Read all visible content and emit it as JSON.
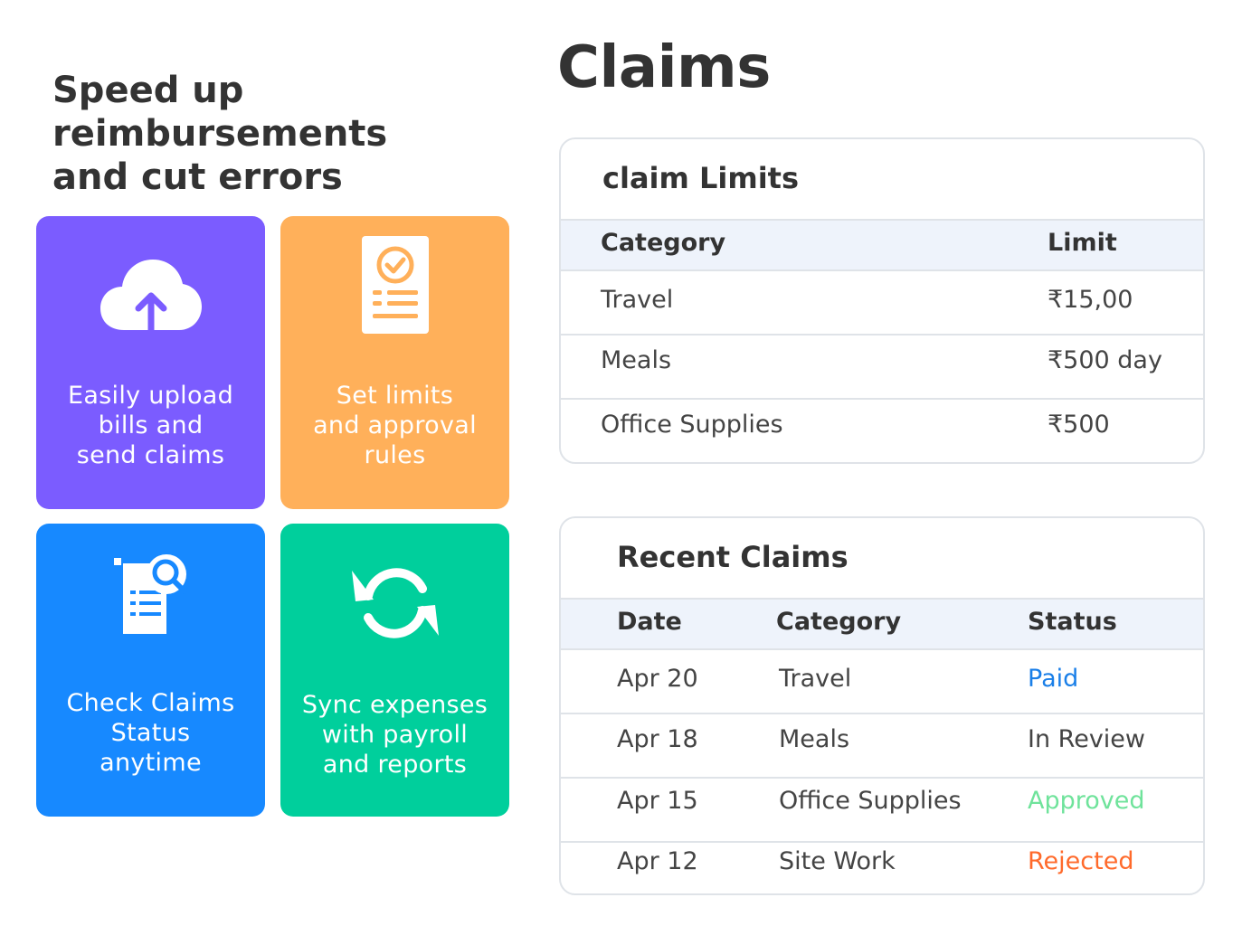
{
  "tagline": "Speed up\nreimbursements\nand cut errors",
  "features": [
    {
      "label": "Easily upload\nbills and\nsend claims",
      "icon": "cloud-upload-icon",
      "color": "#7b5cff"
    },
    {
      "label": "Set  limits\nand approval\nrules",
      "icon": "checklist-document-icon",
      "color": "#ffb05a"
    },
    {
      "label": "Check Claims\nStatus\nanytime",
      "icon": "document-search-icon",
      "color": "#1789ff"
    },
    {
      "label": "Sync expenses\nwith payroll\nand reports",
      "icon": "sync-icon",
      "color": "#00cf9c"
    }
  ],
  "page_title": "Claims",
  "claim_limits": {
    "title": "claim Limits",
    "headers": [
      "Category",
      "Limit"
    ],
    "rows": [
      {
        "category": "Travel",
        "limit": "₹15,00"
      },
      {
        "category": "Meals",
        "limit": "₹500 day"
      },
      {
        "category": "Office Supplies",
        "limit": "₹500"
      }
    ]
  },
  "recent_claims": {
    "title": "Recent Claims",
    "headers": [
      "Date",
      "Category",
      "Status"
    ],
    "rows": [
      {
        "date": "Apr 20",
        "category": "Travel",
        "status": "Paid",
        "status_color": "#1a7fe8"
      },
      {
        "date": "Apr 18",
        "category": "Meals",
        "status": "In Review",
        "status_color": "#444444"
      },
      {
        "date": "Apr 15",
        "category": "Office Supplies",
        "status": "Approved",
        "status_color": "#6fe39b"
      },
      {
        "date": "Apr 12",
        "category": "Site Work",
        "status": "Rejected",
        "status_color": "#ff6a2b"
      }
    ]
  }
}
